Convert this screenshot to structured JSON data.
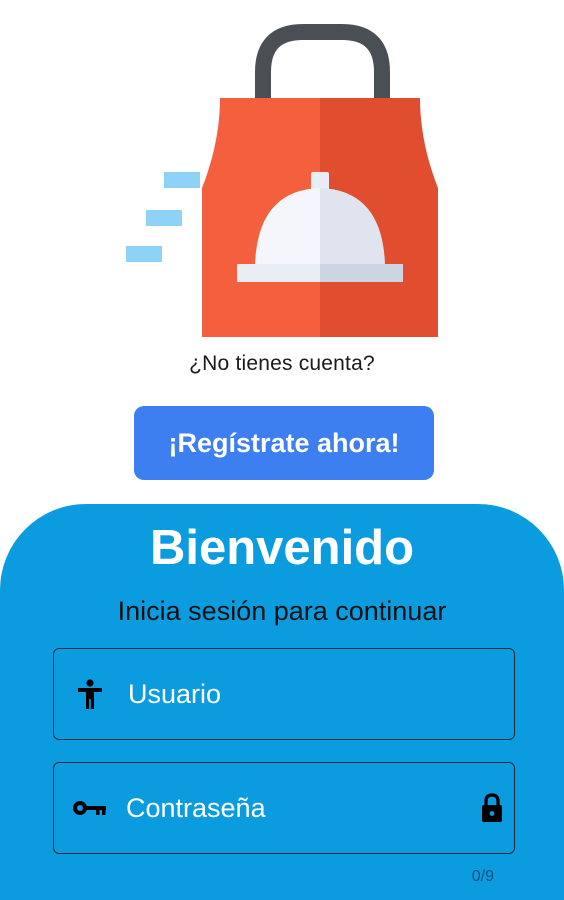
{
  "illustration": {
    "icon": "food-delivery-bag-icon"
  },
  "register": {
    "prompt": "¿No tienes cuenta?",
    "button_label": "¡Regístrate ahora!"
  },
  "login": {
    "title": "Bienvenido",
    "subtitle": "Inicia sesión para continuar",
    "username": {
      "placeholder": "Usuario",
      "value": "",
      "icon": "accessibility-person-icon"
    },
    "password": {
      "placeholder": "Contraseña",
      "value": "",
      "icon": "key-icon",
      "trailing_icon": "lock-icon",
      "counter": "0/9"
    }
  },
  "colors": {
    "register_button": "#3d7ef0",
    "panel": "#0b9ce0",
    "bag_left": "#f4603d",
    "bag_right": "#e04d2f",
    "handle": "#4a4f55",
    "speed_lines": "#8ed2f7"
  }
}
